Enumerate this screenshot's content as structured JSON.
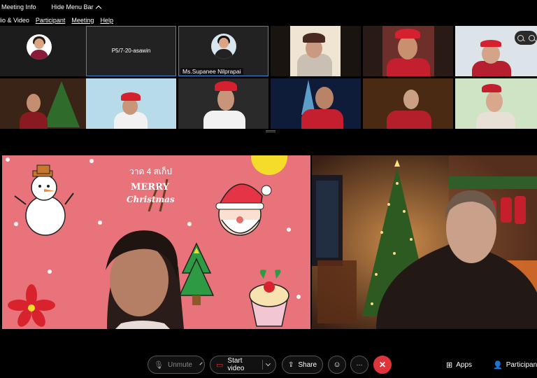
{
  "top_bar": {
    "meeting_info": "Meeting Info",
    "hide_menu": "Hide Menu Bar"
  },
  "menu": [
    {
      "label": "dio & Video"
    },
    {
      "label": "Participant"
    },
    {
      "label": "Meeting"
    },
    {
      "label": "Help"
    }
  ],
  "tiles": [
    {
      "name": ""
    },
    {
      "name": "P5/7-20-asawin"
    },
    {
      "name": "Ms.Supanee Nilprapai"
    }
  ],
  "stage_left": {
    "thai_text": "วาด 4 สเก็ป",
    "merry": "MERRY",
    "christmas": "Christmas"
  },
  "controls": {
    "unmute": "Unmute",
    "start_video": "Start video",
    "share": "Share",
    "more": "···",
    "end": "✕",
    "apps": "Apps",
    "participants": "Participan"
  },
  "colors": {
    "accent_outline": "#3d86d6",
    "end_red": "#e0343b",
    "stage_pink": "#e9737b"
  }
}
